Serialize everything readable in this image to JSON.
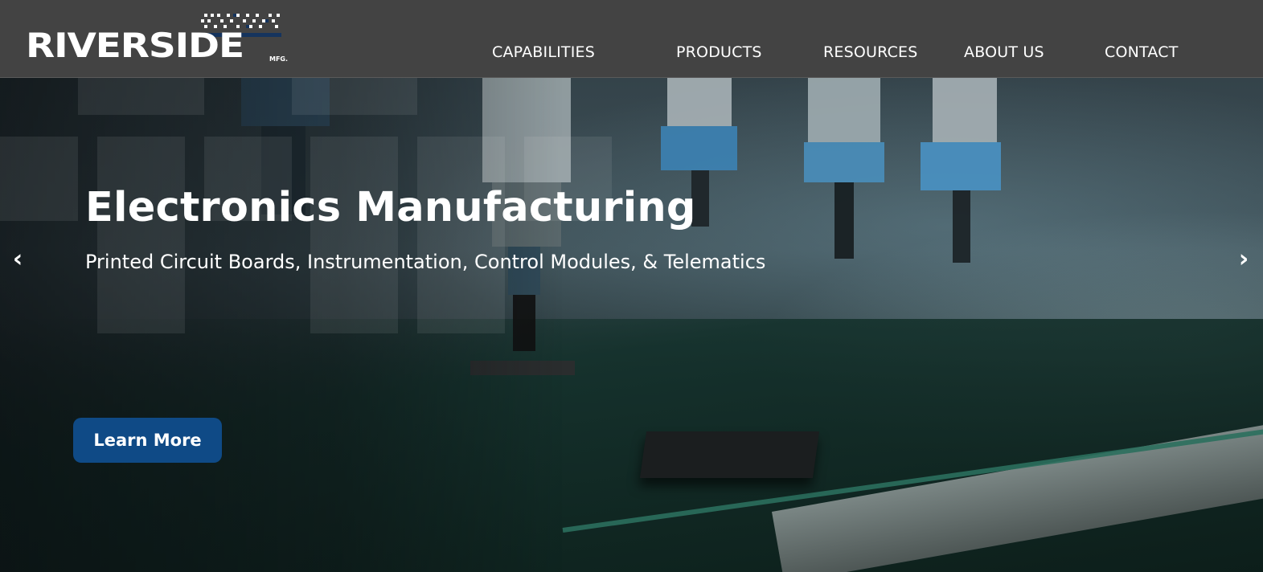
{
  "brand": {
    "name": "RIVERSIDE",
    "suffix": "MFG."
  },
  "nav": {
    "items": [
      {
        "label": "CAPABILITIES"
      },
      {
        "label": "PRODUCTS"
      },
      {
        "label": "RESOURCES"
      },
      {
        "label": "ABOUT US"
      },
      {
        "label": "CONTACT"
      }
    ]
  },
  "hero": {
    "title": "Electronics Manufacturing",
    "subtitle": "Printed Circuit Boards, Instrumentation, Control Modules, & Telematics",
    "cta_label": "Learn More",
    "prev_glyph": "‹",
    "next_glyph": "›",
    "background_icon": "electronics-assembly-photo"
  },
  "colors": {
    "header_bg": "#434343",
    "cta_bg": "#0f4a86",
    "logo_accent": "#15345e",
    "text": "#ffffff"
  }
}
